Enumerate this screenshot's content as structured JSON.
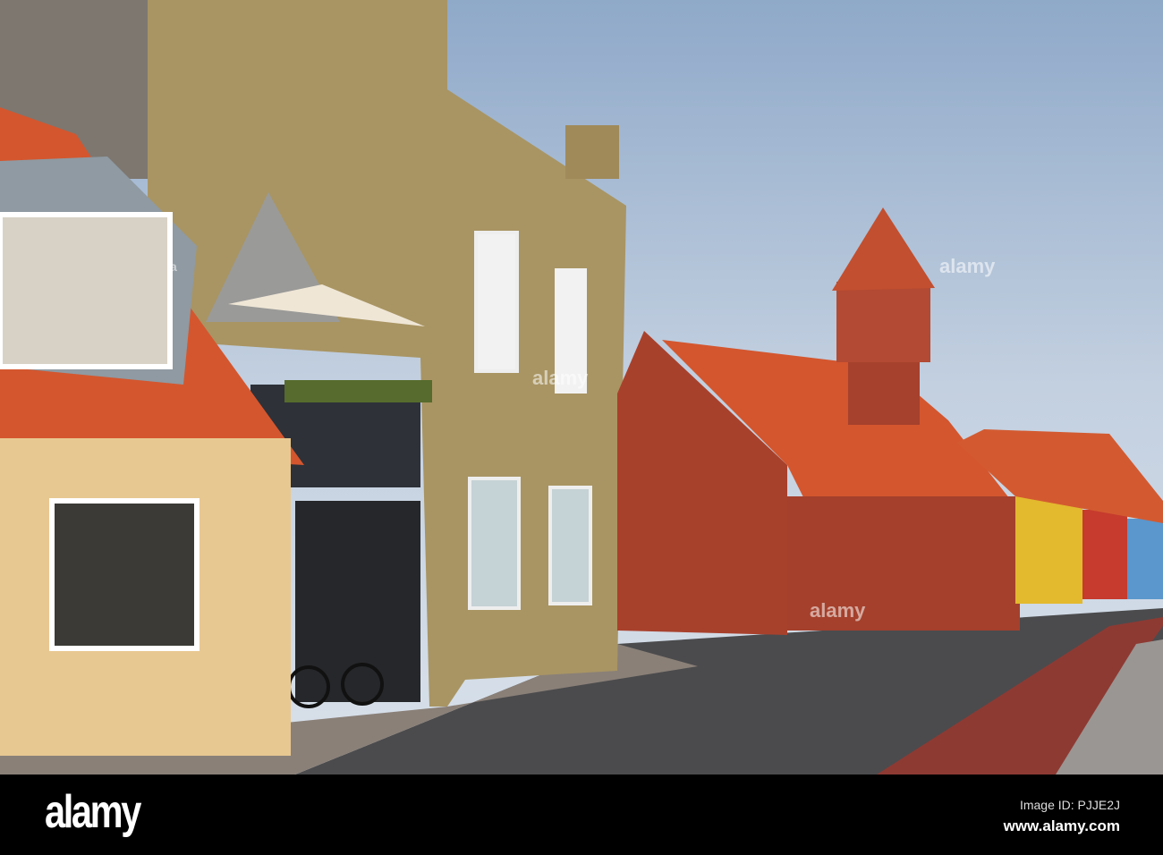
{
  "watermark": {
    "logo": "alamy",
    "image_id": "Image ID: PJJE2J",
    "website": "www.alamy.com"
  },
  "colors": {
    "sky": "#a9bfd8",
    "roof_tile": "#d4562e",
    "brick_red": "#a8412c",
    "yellow_brick": "#b7a36a",
    "road": "#4a4a4c",
    "bike_lane": "#8d3a33"
  }
}
